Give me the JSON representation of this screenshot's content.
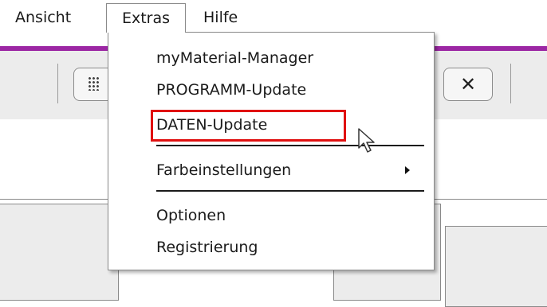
{
  "menubar": {
    "items": [
      {
        "label": "Ansicht"
      },
      {
        "label": "Extras"
      },
      {
        "label": "Hilfe"
      }
    ]
  },
  "toolbar": {
    "grid_icon": "grid-icon",
    "close_label": "✕"
  },
  "extras_menu": {
    "items": [
      {
        "label": "myMaterial-Manager"
      },
      {
        "label": "PROGRAMM-Update"
      },
      {
        "label": "DATEN-Update"
      },
      {
        "label": "Farbeinstellungen"
      },
      {
        "label": "Optionen"
      },
      {
        "label": "Registrierung"
      }
    ],
    "highlighted": "DATEN-Update",
    "submenu_icon": "chevron-right-icon"
  },
  "colors": {
    "accent_bar": "#9c27a4",
    "highlight_border": "#e01010",
    "toolbar_bg": "#ececec"
  }
}
